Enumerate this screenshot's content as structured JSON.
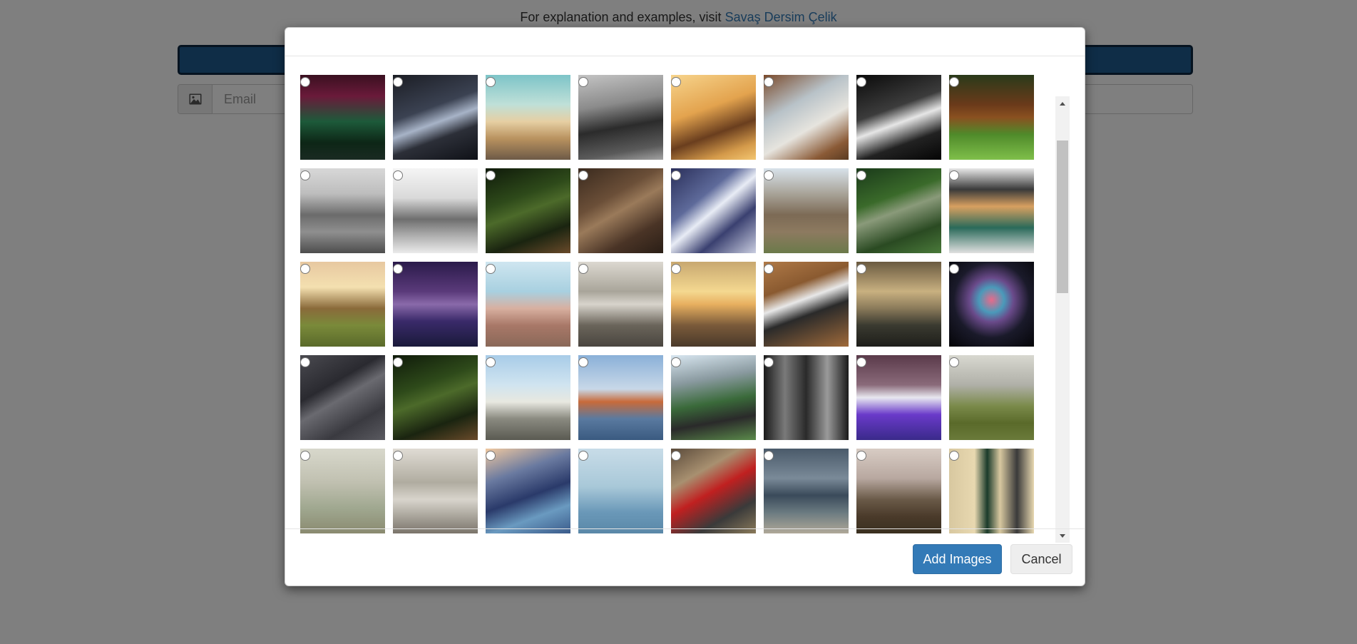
{
  "background": {
    "explanation_text": "For explanation and examples, visit",
    "explanation_link": "Savaş Dersim Çelik",
    "email_placeholder": "Email",
    "bar_color": "#1e5a8e"
  },
  "modal": {
    "footer": {
      "add_images_label": "Add Images",
      "cancel_label": "Cancel"
    },
    "images": [
      {
        "name": "aurora-forest-image",
        "bg": "linear-gradient(180deg,#3a1020 0%,#6a1a3a 25%,#1d5a3a 55%,#0d2616 80%,#1a2a22 100%)"
      },
      {
        "name": "sailboat-mast-image",
        "bg": "linear-gradient(160deg,#1b1d24 0%,#3b4252 40%,#a7b3c7 55%,#2c2f38 70%,#0f1117 100%)"
      },
      {
        "name": "desert-road-image",
        "bg": "linear-gradient(180deg,#7dc4c8 0%,#bfe0d8 35%,#e6cfa3 55%,#b9925f 75%,#6d5a47 100%)"
      },
      {
        "name": "vintage-car-image",
        "bg": "linear-gradient(170deg,#c4c4c4 0%,#8b8b8b 35%,#2b2b2b 60%,#5a5a5a 85%,#a3a3a3 100%)"
      },
      {
        "name": "girl-sunset-image",
        "bg": "linear-gradient(160deg,#f7d48c 0%,#e3a34e 40%,#6a3e1e 65%,#d49a4a 85%,#f3c671 100%)"
      },
      {
        "name": "laptop-desk-image",
        "bg": "linear-gradient(150deg,#7a4a2b 0%,#b8c2c8 35%,#e6e4de 60%,#8a5a36 85%,#5a3b22 100%)"
      },
      {
        "name": "concert-bw-image",
        "bg": "linear-gradient(160deg,#0a0a0a 0%,#3c3c3c 40%,#e6e6e6 55%,#222 75%,#050505 100%)"
      },
      {
        "name": "dog-grass-image",
        "bg": "linear-gradient(180deg,#2a3a1a 0%,#6a3a1a 35%,#8a5020 50%,#4f8a2a 70%,#7fbf4a 100%)"
      },
      {
        "name": "cliff-houses-image",
        "bg": "linear-gradient(180deg,#d8d8d8 0%,#bdbdbd 30%,#6b6b6b 55%,#8f8f8f 75%,#4d4d4d 100%)"
      },
      {
        "name": "flatiron-building-image",
        "bg": "linear-gradient(180deg,#f5f5f5 0%,#d9d9d9 35%,#6e6e6e 60%,#b0b0b0 80%,#ebebeb 100%)"
      },
      {
        "name": "night-sky-fence-image",
        "bg": "linear-gradient(160deg,#0f1a0a 0%,#2e4a1a 35%,#4c6a2a 50%,#1a2410 75%,#6a4a2a 100%)"
      },
      {
        "name": "tools-table-image",
        "bg": "linear-gradient(150deg,#3a2a1e 0%,#6b4f38 35%,#9a7a5a 50%,#4a3426 75%,#2a1e16 100%)"
      },
      {
        "name": "building-glass-image",
        "bg": "linear-gradient(140deg,#2a2f5a 0%,#5e6a9a 35%,#e8ecf5 50%,#3a4070 70%,#c9cde0 100%)"
      },
      {
        "name": "misty-forest-path-image",
        "bg": "linear-gradient(180deg,#d8e2ea 0%,#a8a398 30%,#7c6a55 55%,#8d7a60 75%,#6b7a4a 100%)"
      },
      {
        "name": "green-ravine-image",
        "bg": "linear-gradient(160deg,#1a3a1a 0%,#3a6a2a 35%,#8a9a7a 50%,#2a4a22 75%,#4a7a3a 100%)"
      },
      {
        "name": "clothes-hangers-image",
        "bg": "linear-gradient(180deg,#e8e8e8 0%,#3a3a3a 25%,#d8a060 45%,#2a6a5a 70%,#e0e0e0 100%)"
      },
      {
        "name": "sunset-field-image",
        "bg": "linear-gradient(180deg,#e7c8a0 0%,#f4e0b0 30%,#8a6a3a 55%,#7a8a3a 75%,#5a6a2a 100%)"
      },
      {
        "name": "bridge-night-image",
        "bg": "linear-gradient(180deg,#2a1a4a 0%,#5a3a7a 35%,#8a6aaa 50%,#3a2a6a 70%,#1a1a3a 100%)"
      },
      {
        "name": "woman-beach-image",
        "bg": "linear-gradient(180deg,#cfe6f0 0%,#a8d0e0 35%,#d8b0a0 55%,#a87868 75%,#8a6858 100%)"
      },
      {
        "name": "city-shore-image",
        "bg": "linear-gradient(180deg,#dcd8d0 0%,#a9a59a 35%,#d8d4cc 50%,#6a645a 75%,#4a4640 100%)"
      },
      {
        "name": "golden-field-image",
        "bg": "linear-gradient(180deg,#c8a870 0%,#f4d890 35%,#e8b060 50%,#7a5a3a 75%,#4a3a2a 100%)"
      },
      {
        "name": "laptop-wood-image",
        "bg": "linear-gradient(160deg,#b07a48 0%,#8a5a30 30%,#e8e8e8 45%,#2a2a2a 60%,#a06a3a 100%)"
      },
      {
        "name": "hazy-hills-image",
        "bg": "linear-gradient(180deg,#6a5a40 0%,#c8b080 35%,#8a7a5a 55%,#3a3a30 75%,#1e1e1a 100%)"
      },
      {
        "name": "fireworks-image",
        "bg": "radial-gradient(circle at 50% 45%,#e86a8a 0%,#4a9aba 20%,#6a4a8a 35%,#1a1a2a 60%,#050508 100%)"
      },
      {
        "name": "gadgets-flatlay-image",
        "bg": "linear-gradient(150deg,#4a4a50 0%,#2a2a30 35%,#6a6a70 50%,#3a3a40 75%,#5a5a60 100%)"
      },
      {
        "name": "night-sky-fence-2-image",
        "bg": "linear-gradient(160deg,#0f1a0a 0%,#2e4a1a 35%,#4c6a2a 50%,#1a2410 75%,#6a4a2a 100%)"
      },
      {
        "name": "industrial-silos-image",
        "bg": "linear-gradient(180deg,#a8cce8 0%,#d0e4f0 35%,#e8e8e0 55%,#8a8a80 75%,#5a5a52 100%)"
      },
      {
        "name": "ship-crane-image",
        "bg": "linear-gradient(180deg,#8ab0d8 0%,#c8d8e8 40%,#c86a3a 55%,#5a7aa0 75%,#3a5a80 100%)"
      },
      {
        "name": "mountain-road-image",
        "bg": "linear-gradient(170deg,#d8e6f0 0%,#8a9aa0 30%,#3a6a3a 55%,#2a2a2a 75%,#5a8a4a 100%)"
      },
      {
        "name": "bw-building-image",
        "bg": "linear-gradient(90deg,#1a1a1a 0%,#7a7a7a 25%,#2a2a2a 50%,#9a9a9a 75%,#1a1a1a 100%)"
      },
      {
        "name": "cathedral-night-image",
        "bg": "linear-gradient(180deg,#5a3a4a 0%,#8a6a7a 35%,#e8e8f0 50%,#6a3aca 70%,#3a2a8a 100%)"
      },
      {
        "name": "foggy-tree-image",
        "bg": "linear-gradient(180deg,#d8d8d0 0%,#b0b0a8 35%,#7a8a4a 60%,#5a6a2a 80%,#6a7a3a 100%)"
      },
      {
        "name": "misty-beach-image",
        "bg": "linear-gradient(180deg,#d8d8cc 0%,#c0c0b0 40%,#a0a890 70%,#8a8a70 100%)"
      },
      {
        "name": "city-shore-2-image",
        "bg": "linear-gradient(180deg,#e0dcd4 0%,#b0aca0 40%,#d8d4cc 60%,#7a746a 100%)"
      },
      {
        "name": "coastal-road-image",
        "bg": "linear-gradient(160deg,#f0c8a0 0%,#6a7aa0 30%,#2a3a6a 55%,#6a9ac0 75%,#3a5a8a 100%)"
      },
      {
        "name": "calm-sea-image",
        "bg": "linear-gradient(180deg,#c8dce8 0%,#a8c8d8 45%,#6a98b8 75%,#5a88a8 100%)"
      },
      {
        "name": "red-phone-booth-image",
        "bg": "linear-gradient(150deg,#5a4a3a 0%,#a89070 30%,#c02020 50%,#3a3a3a 75%,#8a7a5a 100%)"
      },
      {
        "name": "stormy-coast-image",
        "bg": "linear-gradient(180deg,#4a5a6a 0%,#7a8a98 35%,#3a4a5a 55%,#6a7a80 75%,#b0a898 100%)"
      },
      {
        "name": "foggy-trees-2-image",
        "bg": "linear-gradient(180deg,#d8ccc4 0%,#b8a8a0 35%,#6a5a48 60%,#4a3a2a 80%,#3a3020 100%)"
      },
      {
        "name": "door-window-image",
        "bg": "linear-gradient(90deg,#d8c8a0 0%,#e8d8b0 30%,#1a3a2a 45%,#d8c8a0 60%,#3a3a3a 80%,#e8d8b0 100%)"
      }
    ]
  }
}
